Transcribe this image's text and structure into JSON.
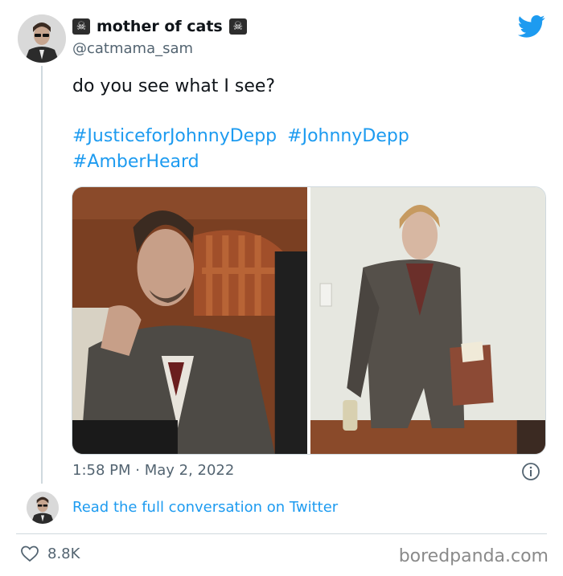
{
  "tweet": {
    "display_name": "mother of cats",
    "name_emoji": "☠",
    "handle": "@catmama_sam",
    "text": "do you see what I see?",
    "hashtags": [
      "#JusticeforJohnnyDepp",
      "#JohnnyDepp",
      "#AmberHeard"
    ],
    "timestamp": "1:58 PM · May 2, 2022",
    "read_link": "Read the full conversation on Twitter",
    "likes": "8.8K"
  },
  "icons": {
    "brand": "twitter-bird-icon",
    "info": "info-icon",
    "like": "heart-icon"
  },
  "colors": {
    "accent": "#1d9bf0",
    "muted": "#536471"
  },
  "watermark": "boredpanda.com"
}
